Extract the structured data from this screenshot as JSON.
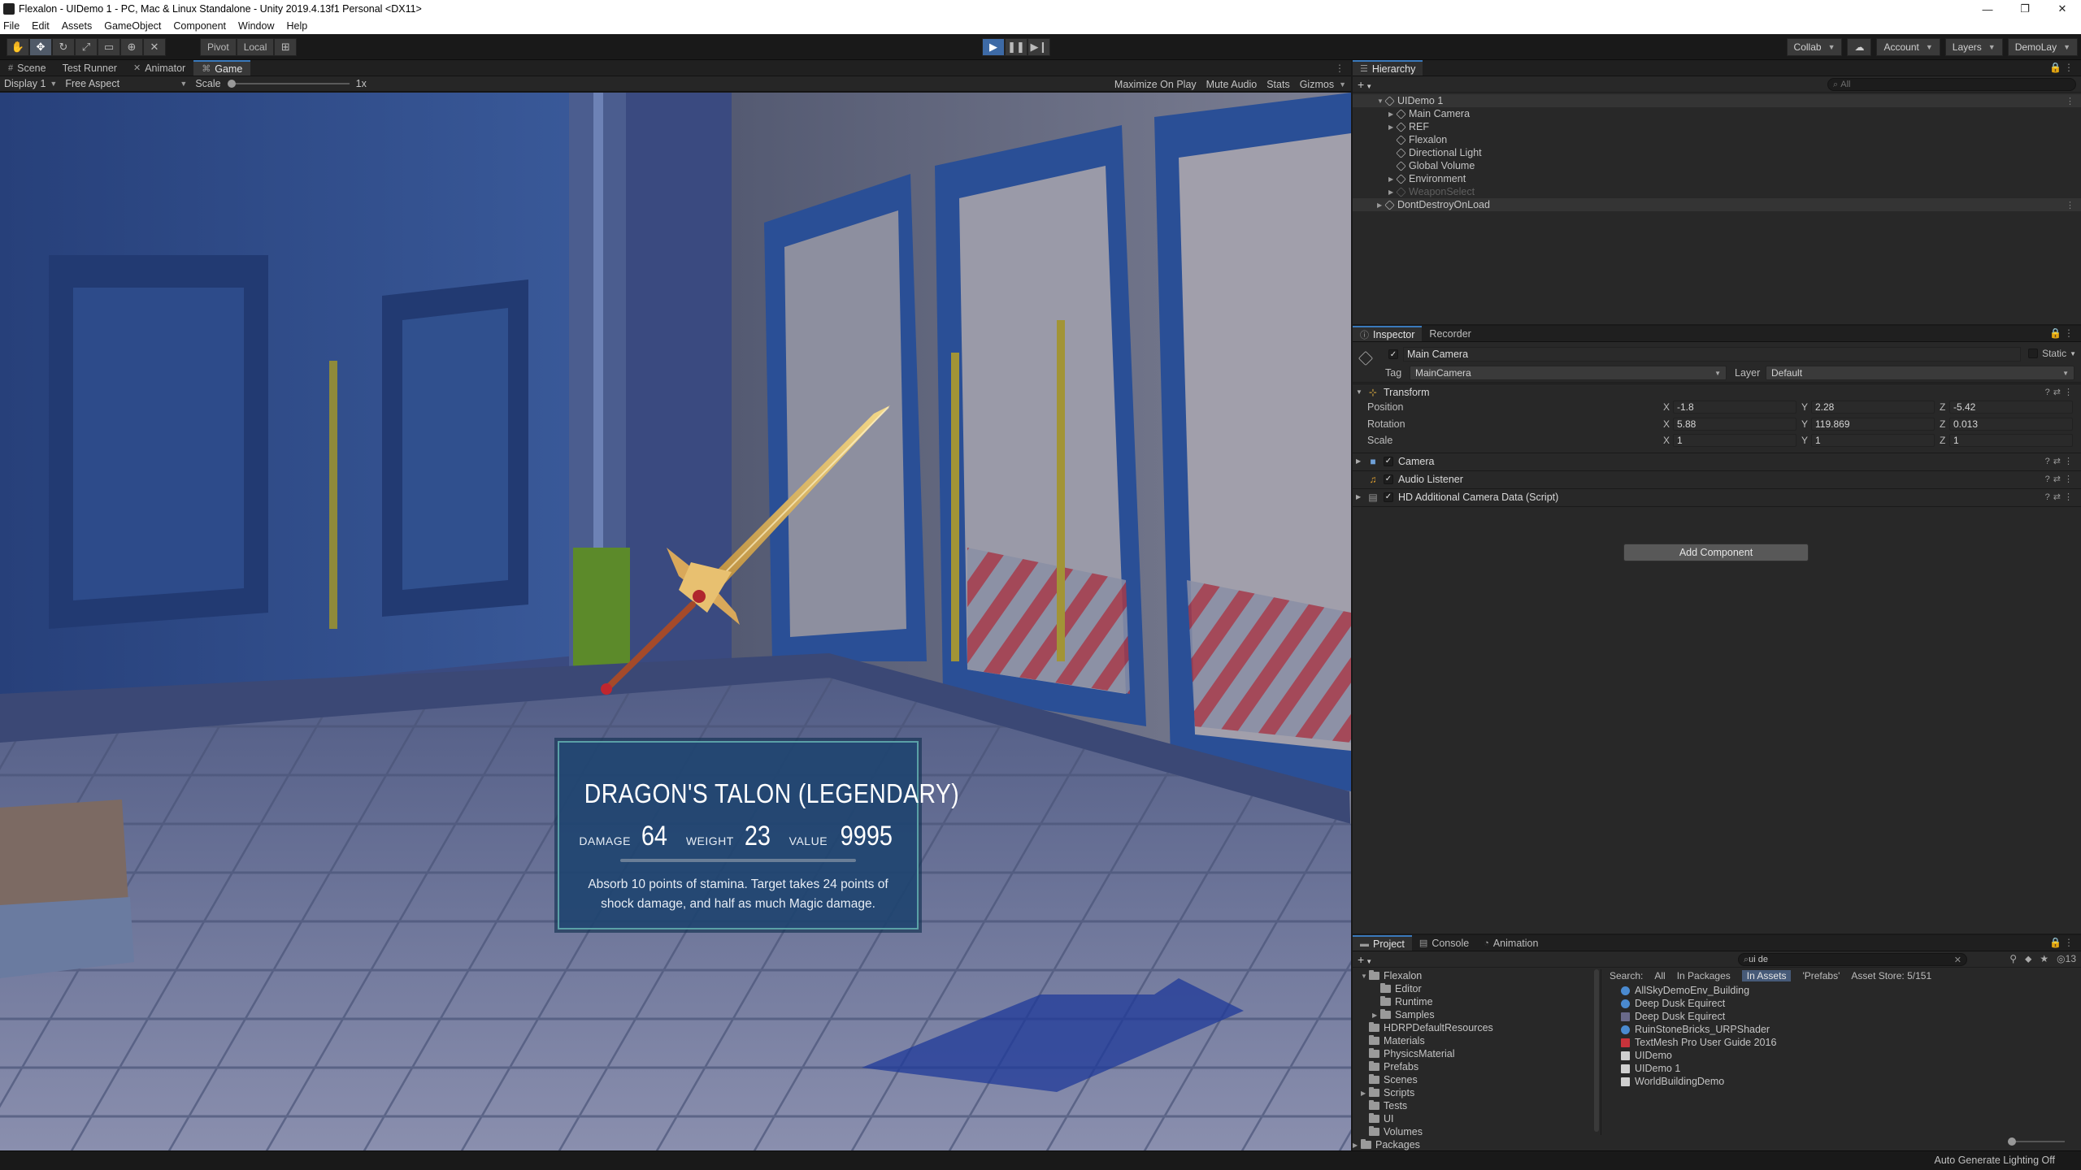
{
  "window": {
    "title": "Flexalon - UIDemo 1 - PC, Mac & Linux Standalone - Unity 2019.4.13f1 Personal <DX11>",
    "minimize_glyph": "—",
    "maximize_glyph": "❐",
    "close_glyph": "✕"
  },
  "menu": [
    "File",
    "Edit",
    "Assets",
    "GameObject",
    "Component",
    "Window",
    "Help"
  ],
  "toolbar": {
    "pivot": "Pivot",
    "local": "Local",
    "collab": "Collab",
    "account": "Account",
    "layers": "Layers",
    "layout": "DemoLay"
  },
  "game_panel": {
    "tabs": [
      "Scene",
      "Test Runner",
      "Animator",
      "Game"
    ],
    "active_tab": "Game",
    "display": "Display 1",
    "aspect": "Free Aspect",
    "scale_label": "Scale",
    "scale_value": "1x",
    "options": [
      "Maximize On Play",
      "Mute Audio",
      "Stats",
      "Gizmos"
    ]
  },
  "item_card": {
    "name": "DRAGON'S TALON (LEGENDARY)",
    "damage_label": "DAMAGE",
    "damage_value": "64",
    "weight_label": "WEIGHT",
    "weight_value": "23",
    "value_label": "VALUE",
    "value_value": "9995",
    "description": "Absorb 10 points of stamina. Target takes 24 points of shock damage, and half as much Magic damage."
  },
  "hierarchy": {
    "tab": "Hierarchy",
    "search_placeholder": "All",
    "scene": "UIDemo 1",
    "items": [
      "Main Camera",
      "REF",
      "Flexalon",
      "Directional Light",
      "Global Volume",
      "Environment",
      "WeaponSelect"
    ],
    "dont_destroy": "DontDestroyOnLoad"
  },
  "inspector": {
    "tabs": [
      "Inspector",
      "Recorder"
    ],
    "object_name": "Main Camera",
    "static_label": "Static",
    "tag_label": "Tag",
    "tag_value": "MainCamera",
    "layer_label": "Layer",
    "layer_value": "Default",
    "transform": {
      "title": "Transform",
      "position_label": "Position",
      "rotation_label": "Rotation",
      "scale_label": "Scale",
      "position": {
        "x": "-1.8",
        "y": "2.28",
        "z": "-5.42"
      },
      "rotation": {
        "x": "5.88",
        "y": "119.869",
        "z": "0.013"
      },
      "scale": {
        "x": "1",
        "y": "1",
        "z": "1"
      }
    },
    "components": [
      "Camera",
      "Audio Listener",
      "HD Additional Camera Data (Script)"
    ],
    "add_component": "Add Component"
  },
  "project": {
    "tabs": [
      "Project",
      "Console",
      "Animation"
    ],
    "search_value": "ui de",
    "search_filters": {
      "label": "Search:",
      "all": "All",
      "in_packages": "In Packages",
      "in_assets": "In Assets",
      "prefabs": "'Prefabs'",
      "asset_store": "Asset Store: 5/151"
    },
    "hidden_count": "13",
    "folders": [
      "Flexalon",
      "Editor",
      "Runtime",
      "Samples",
      "HDRPDefaultResources",
      "Materials",
      "PhysicsMaterial",
      "Prefabs",
      "Scenes",
      "Scripts",
      "Tests",
      "UI",
      "Volumes",
      "Packages"
    ],
    "results": [
      "AllSkyDemoEnv_Building",
      "Deep Dusk Equirect",
      "Deep Dusk Equirect",
      "RuinStoneBricks_URPShader",
      "TextMesh Pro User Guide 2016",
      "UIDemo",
      "UIDemo 1",
      "WorldBuildingDemo"
    ]
  },
  "status": {
    "right_text": "Auto Generate Lighting Off"
  },
  "colors": {
    "editor_bg": "#191919",
    "panel_bg": "#282828",
    "accent_blue": "#3a79bb",
    "card_bg": "#204470",
    "card_border": "#5aa0a6"
  }
}
